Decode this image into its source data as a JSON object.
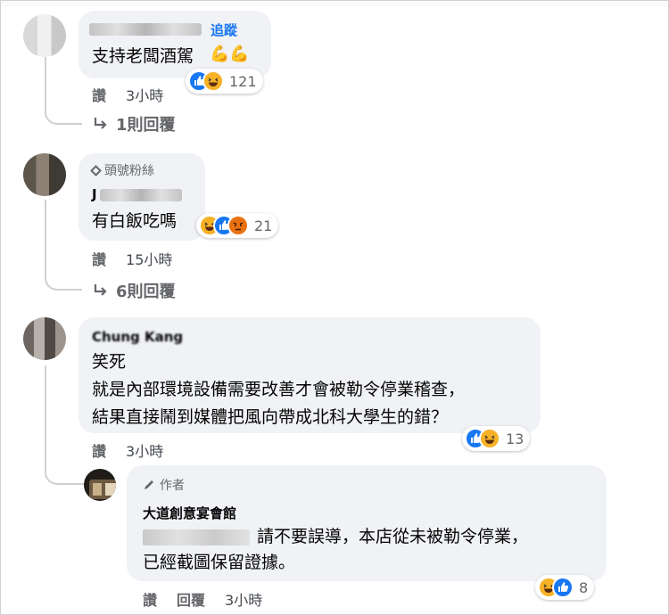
{
  "comments": [
    {
      "name_visible": "",
      "follow_label": "追蹤",
      "text_lines": [
        "支持老闆酒駕"
      ],
      "inline_emoji": "💪💪",
      "like_label": "讚",
      "time": "3小時",
      "reaction_count": "121",
      "reactions": [
        "like",
        "haha"
      ],
      "replies_label": "1則回覆"
    },
    {
      "badge": "頭號粉絲",
      "name_visible": "J",
      "text_lines": [
        "有白飯吃嗎"
      ],
      "like_label": "讚",
      "time": "15小時",
      "reaction_count": "21",
      "reactions": [
        "haha",
        "like",
        "angry"
      ],
      "replies_label": "6則回覆"
    },
    {
      "name_visible": "Chung Kang",
      "text_lines": [
        "笑死",
        "就是內部環境設備需要改善才會被勒令停業稽查，",
        "結果直接鬧到媒體把風向帶成北科大學生的錯？"
      ],
      "like_label": "讚",
      "time": "3小時",
      "reaction_count": "13",
      "reactions": [
        "like",
        "haha"
      ]
    }
  ],
  "reply": {
    "badge": "作者",
    "name": "大道創意宴會館",
    "text_line1": "請不要誤導，本店從未被勒令停業，",
    "text_line2": "已經截圖保留證據。",
    "like_label": "讚",
    "reply_label": "回覆",
    "time": "3小時",
    "reaction_count": "8",
    "reactions": [
      "haha",
      "like"
    ]
  },
  "colors": {
    "accent": "#1877f2",
    "bubble": "#f0f2f5",
    "muted": "#65676b"
  }
}
